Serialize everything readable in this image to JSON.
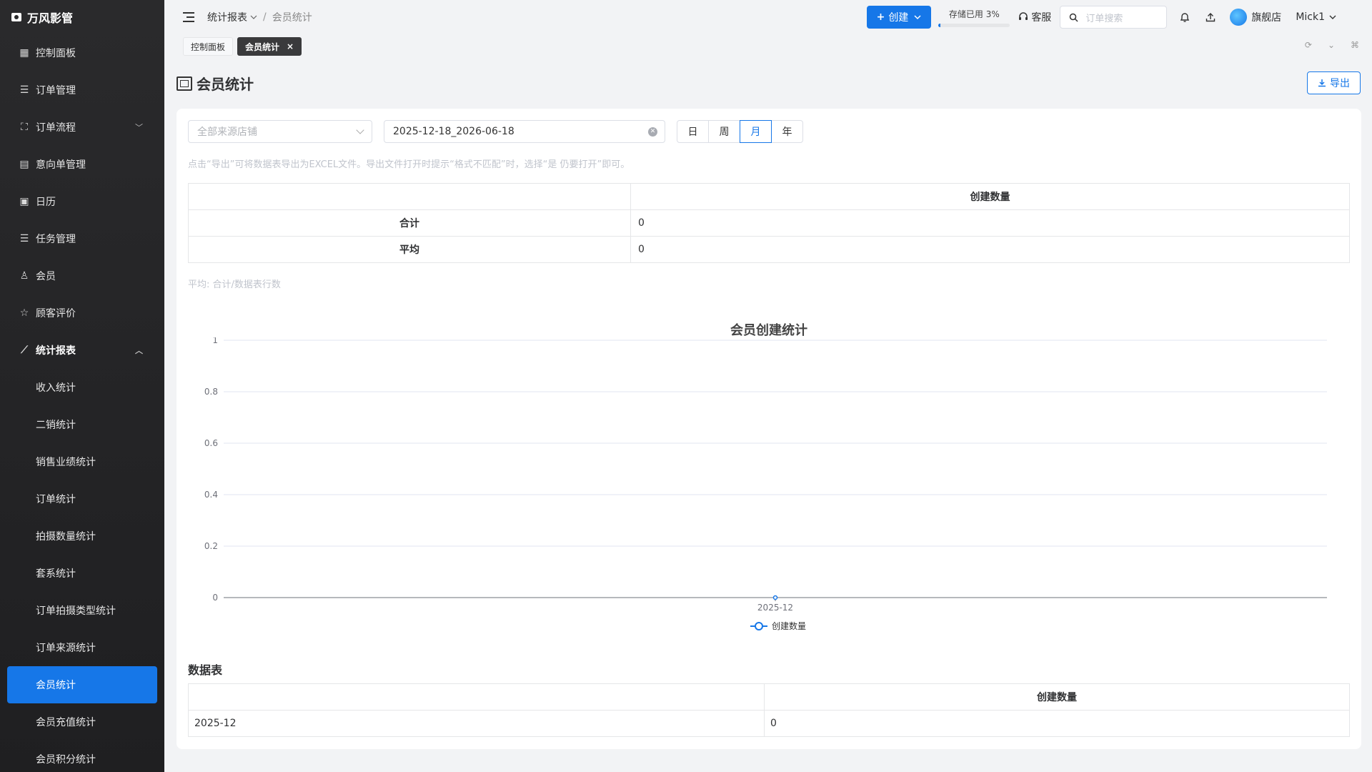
{
  "brand": {
    "name": "万风影管"
  },
  "sidebar": {
    "items": [
      {
        "label": "控制面板",
        "icon": "dashboard-icon"
      },
      {
        "label": "订单管理",
        "icon": "list-icon"
      },
      {
        "label": "订单流程",
        "icon": "flow-icon",
        "expandable": true
      },
      {
        "label": "意向单管理",
        "icon": "document-icon"
      },
      {
        "label": "日历",
        "icon": "calendar-icon"
      },
      {
        "label": "任务管理",
        "icon": "task-icon"
      },
      {
        "label": "会员",
        "icon": "user-icon"
      },
      {
        "label": "顾客评价",
        "icon": "star-icon"
      },
      {
        "label": "统计报表",
        "icon": "chart-icon",
        "expanded": true
      }
    ],
    "sub_items": [
      "收入统计",
      "二销统计",
      "销售业绩统计",
      "订单统计",
      "拍摄数量统计",
      "套系统计",
      "订单拍摄类型统计",
      "订单来源统计",
      "会员统计",
      "会员充值统计",
      "会员积分统计"
    ],
    "active_sub": "会员统计"
  },
  "topbar": {
    "breadcrumb_parent": "统计报表",
    "breadcrumb_current": "会员统计",
    "create_label": "创建",
    "storage_label": "存储已用 3%",
    "storage_used_fraction": 0.03,
    "service_label": "客服",
    "search_placeholder": "订单搜索",
    "store_name": "旗舰店",
    "user_name": "Mick1"
  },
  "tabs": [
    {
      "label": "控制面板",
      "active": false
    },
    {
      "label": "会员统计",
      "active": true
    }
  ],
  "page": {
    "title": "会员统计",
    "export_label": "导出"
  },
  "filters": {
    "store_placeholder": "全部来源店铺",
    "date_range": "2025-12-18_2026-06-18",
    "granularity": [
      "日",
      "周",
      "月",
      "年"
    ],
    "granularity_selected": "月"
  },
  "hint": "点击“导出”可将数据表导出为EXCEL文件。导出文件打开时提示“格式不匹配”时，选择“是 仍要打开”即可。",
  "summary": {
    "header": "创建数量",
    "rows": [
      {
        "label": "合计",
        "value": "0"
      },
      {
        "label": "平均",
        "value": "0"
      }
    ],
    "note": "平均: 合计/数据表行数"
  },
  "chart_data": {
    "type": "line",
    "title": "会员创建统计",
    "categories": [
      "2025-12"
    ],
    "series": [
      {
        "name": "创建数量",
        "values": [
          0
        ]
      }
    ],
    "ylim": [
      0,
      1
    ],
    "yticks": [
      "0",
      "0.2",
      "0.4",
      "0.6",
      "0.8",
      "1"
    ],
    "grid": true,
    "legend": "bottom-center",
    "color": "#1677e8"
  },
  "data_table": {
    "title": "数据表",
    "header": "创建数量",
    "rows": [
      {
        "period": "2025-12",
        "value": "0"
      }
    ]
  }
}
